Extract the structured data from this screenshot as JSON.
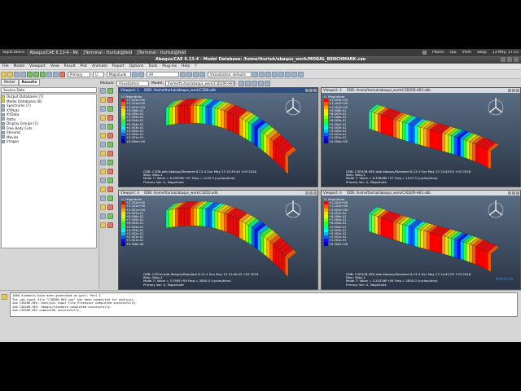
{
  "os_panel": {
    "app_menu": "Applications",
    "places": "Places",
    "tasks": [
      "Abaqus/CAE 6.13-4 - Model...",
      "[Terminal - tturtuk@feldus...",
      "[Terminal - tturtuk@feldus..."
    ],
    "tray": [
      "Places",
      "cpu",
      "mem",
      "swap"
    ],
    "clock": "13 May, 17:15"
  },
  "window": {
    "title": "Abaqus/CAE 6.13-4 - Model Database: /home/tturtuk/abaqus_work/MODAL_BENCHMARK.cae"
  },
  "menubar": {
    "items": [
      "File",
      "Model",
      "Viewport",
      "View",
      "Result",
      "Plot",
      "Animate",
      "Report",
      "Options",
      "Tools",
      "Plug-ins",
      "Help",
      "?"
    ]
  },
  "toolbar": {
    "primary": "Primary",
    "field": "U",
    "component": "Magnitude",
    "all_selector": "All",
    "visualization": "Visualization: defaults"
  },
  "module_row": {
    "module_label": "Module:",
    "module_value": "Visualization",
    "model_label": "Model:",
    "model_value": "/home/tturtuk/abaqus_work/C3D20R-HEX.odb"
  },
  "tree": {
    "tabs": [
      "Model",
      "Results"
    ],
    "filter": "Session Data",
    "nodes": [
      {
        "label": "Output Databases (7)",
        "db": true
      },
      {
        "label": "Model Databases (8)",
        "db": true
      },
      {
        "label": "Spectrums (7)",
        "db": false
      },
      {
        "label": "XYPlots",
        "db": false
      },
      {
        "label": "XYData",
        "db": false
      },
      {
        "label": "Paths",
        "db": false
      },
      {
        "label": "Display Groups (1)",
        "db": false
      },
      {
        "label": "Free Body Cuts",
        "db": false
      },
      {
        "label": "Streams",
        "db": false
      },
      {
        "label": "Movies",
        "db": false
      },
      {
        "label": "Images",
        "db": false
      }
    ]
  },
  "viewports": [
    {
      "num": "Viewport: 1",
      "file": "ODB: /home/tturtuk/abaqus_work/C3D8.odb",
      "legend_title": "U, Magnitude",
      "legend_values": [
        "+1.201e+00",
        "+1.101e+00",
        "+1.001e+00",
        "+9.006e-01",
        "+8.005e-01",
        "+7.005e-01",
        "+6.004e-01",
        "+5.004e-01",
        "+4.003e-01",
        "+3.002e-01",
        "+2.002e-01",
        "+1.001e-01",
        "+0.000e+00"
      ],
      "info": [
        "ODB: C3D8.odb   Abaqus/Standard 6.13-4   Sun May 13 14:35:44 +03 2018",
        "Step: Step-1",
        "Mode    7: Value = 6.03090E+07 Freq = 1232.0   (cycles/time)",
        "Primary Var: U, Magnitude"
      ]
    },
    {
      "num": "Viewport: 2",
      "file": "ODB: /home/tturtuk/abaqus_work/C3D20R-HEX.odb",
      "legend_title": "U, Magnitude",
      "legend_values": [
        "+1.201e+00",
        "+1.101e+00",
        "+1.001e+00",
        "+9.008e-01",
        "+8.007e-01",
        "+7.006e-01",
        "+6.005e-01",
        "+5.004e-01",
        "+4.003e-01",
        "+3.002e-01",
        "+2.001e-01",
        "+1.001e-01",
        "+0.000e+00"
      ],
      "info": [
        "ODB: C3D20R-HEX.odb   Abaqus/Standard 6.13-4   Sun May 13 14:45:04 +03 2018",
        "Step: Step-1",
        "Mode    7: Value = 8.32648E+07 Freq = 1047.3   (cycles/time)",
        "Primary Var: U, Magnitude"
      ]
    },
    {
      "num": "Viewport: 3",
      "file": "ODB: /home/tturtuk/abaqus_work/C3D10.odb",
      "legend_title": "U, Magnitude",
      "legend_values": [
        "+1.201e+00",
        "+1.101e+00",
        "+1.001e+00",
        "+9.007e-01",
        "+8.006e-01",
        "+7.005e-01",
        "+6.004e-01",
        "+5.004e-01",
        "+4.003e-01",
        "+3.002e-01",
        "+2.001e-01",
        "+1.001e-01",
        "+2.328e-06"
      ],
      "info": [
        "ODB: C3D10.odb   Abaqus/Standard 6.13-4   Sun May 13 14:40:03 +03 2018",
        "Step: Step-1",
        "Mode    7: Value = 3.359E+09 Freq = 2850.0   (cycles/time)",
        "Primary Var: U, Magnitude"
      ]
    },
    {
      "num": "Viewport: 4",
      "file": "ODB: /home/tturtuk/abaqus_work/C3D20R-HEX.odb",
      "legend_title": "U, Magnitude",
      "legend_values": [
        "+1.201e+00",
        "+1.101e+00",
        "+1.001e+00",
        "+9.007e-01",
        "+8.006e-01",
        "+7.005e-01",
        "+6.004e-01",
        "+5.004e-01",
        "+4.003e-01",
        "+3.002e-01",
        "+2.001e-01",
        "+1.001e-01",
        "+0.000e+00"
      ],
      "info": [
        "ODB: C3D20R-HEX.odb   Abaqus/Standard 6.13-4   Sun May 13 14:41:03 +03 2018",
        "Step: Step-1",
        "Mode    7: Value = 3.20328E+09 Freq = 2850.0   (cycles/time)",
        "Primary Var: U, Magnitude"
      ]
    }
  ],
  "legend_colors": [
    "#ff0000",
    "#ff5a00",
    "#ffa800",
    "#ffe000",
    "#d8ff00",
    "#8cff00",
    "#2eff28",
    "#00ff8a",
    "#00ffe0",
    "#00b8ff",
    "#0060ff",
    "#0010ff",
    "#0000b4"
  ],
  "messages": [
    "1680 elements have been generated on part: Part-1",
    "The job input file \"C3D20R-HEX.inp\" has been submitted for analysis.",
    "Job C3D20R-HEX: Analysis Input File Processor completed successfully.",
    "Job C3D20R-HEX: Abaqus/Standard completed successfully.",
    "Job C3D20R-HEX completed successfully."
  ],
  "brand": "SIMULIA"
}
